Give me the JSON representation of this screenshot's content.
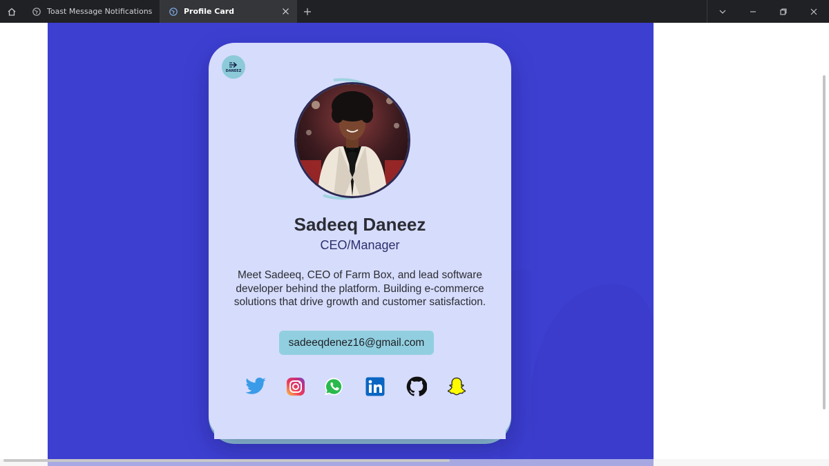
{
  "browser": {
    "tabs": [
      {
        "label": "Toast Message Notifications",
        "icon": "globe-icon",
        "active": false
      },
      {
        "label": "Profile Card",
        "icon": "globe-icon",
        "active": true
      }
    ],
    "controls": [
      "tab-list-icon",
      "minimize-icon",
      "restore-icon",
      "close-icon"
    ]
  },
  "colors": {
    "stage_bg": "#3d3fd1",
    "card_bg": "#d6dcfb",
    "accent": "#91cfe0",
    "name": "#2b2c34",
    "role": "#2e2f6d"
  },
  "profile": {
    "logo_text": "DANEEZ",
    "name": "Sadeeq Daneez",
    "role": "CEO/Manager",
    "bio": "Meet Sadeeq, CEO of Farm Box, and lead software developer behind the platform. Building e-commerce solutions that drive growth and customer satisfaction.",
    "email": "sadeeqdenez16@gmail.com",
    "socials": [
      {
        "name": "twitter",
        "icon": "twitter-icon"
      },
      {
        "name": "instagram",
        "icon": "instagram-icon"
      },
      {
        "name": "whatsapp",
        "icon": "whatsapp-icon"
      },
      {
        "name": "linkedin",
        "icon": "linkedin-icon"
      },
      {
        "name": "github",
        "icon": "github-icon"
      },
      {
        "name": "snapchat",
        "icon": "snapchat-icon"
      }
    ]
  }
}
